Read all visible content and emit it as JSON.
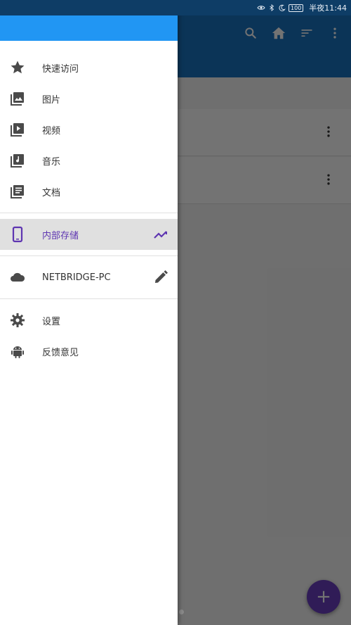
{
  "status_bar": {
    "battery": "100",
    "time": "半夜11:44"
  },
  "drawer": {
    "sections": {
      "library": [
        {
          "label": "快速访问",
          "icon": "star-icon"
        },
        {
          "label": "图片",
          "icon": "image-icon"
        },
        {
          "label": "视频",
          "icon": "video-icon"
        },
        {
          "label": "音乐",
          "icon": "music-icon"
        },
        {
          "label": "文档",
          "icon": "document-icon"
        }
      ],
      "storage": {
        "label": "内部存储",
        "icon": "phone-icon",
        "trailing_icon": "trending-icon",
        "active": true
      },
      "cloud": {
        "label": "NETBRIDGE-PC",
        "icon": "cloud-icon",
        "trailing_icon": "edit-icon"
      },
      "misc": [
        {
          "label": "设置",
          "icon": "gear-icon"
        },
        {
          "label": "反馈意见",
          "icon": "android-icon"
        }
      ]
    }
  },
  "appbar": {
    "actions": [
      "search-icon",
      "home-icon",
      "sort-icon",
      "more-vert-icon"
    ]
  },
  "fab": {
    "label": "+"
  },
  "colors": {
    "status_bar": "#0e3d66",
    "appbar": "#1a73c2",
    "drawer_header": "#2196f3",
    "accent": "#5e35b1",
    "fab": "#6a3fc1"
  }
}
